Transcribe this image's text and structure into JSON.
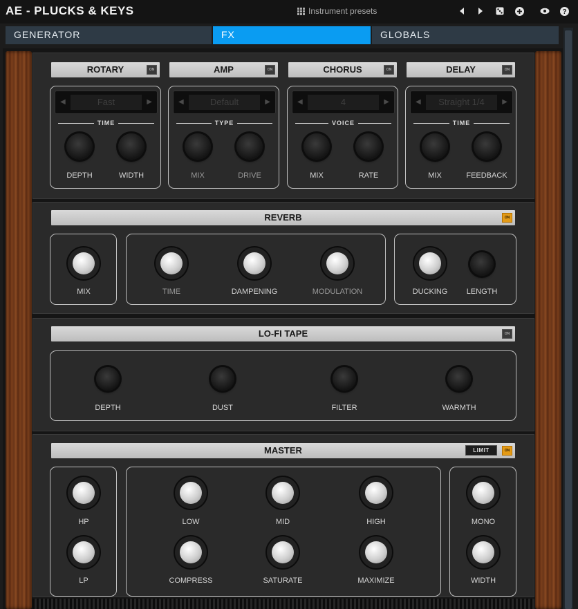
{
  "app": {
    "title": "AE - PLUCKS & KEYS",
    "presets_label": "Instrument presets"
  },
  "titlebar_icons": [
    "chevron-left-icon",
    "chevron-right-icon",
    "dice-icon",
    "plus-circle-icon",
    "eye-icon",
    "help-icon"
  ],
  "tabs": [
    {
      "label": "GENERATOR",
      "active": false
    },
    {
      "label": "FX",
      "active": true
    },
    {
      "label": "GLOBALS",
      "active": false
    }
  ],
  "colors": {
    "accent": "#0a9cf2",
    "on_lit": "#e39a16",
    "panel": "#2a2a2a",
    "wood": "#7b3f1c"
  },
  "rows": {
    "rotary": {
      "title": "ROTARY",
      "on": false,
      "selector_value": "Fast",
      "selector_label": "TIME",
      "knob1": "DEPTH",
      "knob2": "WIDTH"
    },
    "amp": {
      "title": "AMP",
      "on": false,
      "selector_value": "Default",
      "selector_label": "TYPE",
      "knob1": "MIX",
      "knob2": "DRIVE"
    },
    "chorus": {
      "title": "CHORUS",
      "on": false,
      "selector_value": "4",
      "selector_label": "VOICE",
      "knob1": "MIX",
      "knob2": "RATE"
    },
    "delay": {
      "title": "DELAY",
      "on": false,
      "selector_value": "Straight 1/4",
      "selector_label": "TIME",
      "knob1": "MIX",
      "knob2": "FEEDBACK"
    }
  },
  "reverb": {
    "title": "REVERB",
    "on": true,
    "on_label": "ON",
    "knobs": [
      "MIX",
      "TIME",
      "DAMPENING",
      "MODULATION",
      "DUCKING",
      "LENGTH"
    ]
  },
  "lofi": {
    "title": "LO-FI TAPE",
    "on": false,
    "knobs": [
      "DEPTH",
      "DUST",
      "FILTER",
      "WARMTH"
    ]
  },
  "master": {
    "title": "MASTER",
    "limit_label": "LIMIT",
    "on": true,
    "on_label": "ON",
    "left": [
      "HP",
      "LP"
    ],
    "center_top": [
      "LOW",
      "MID",
      "HIGH"
    ],
    "center_bottom": [
      "COMPRESS",
      "SATURATE",
      "MAXIMIZE"
    ],
    "right": [
      "MONO",
      "WIDTH"
    ]
  },
  "on_text": "ON"
}
